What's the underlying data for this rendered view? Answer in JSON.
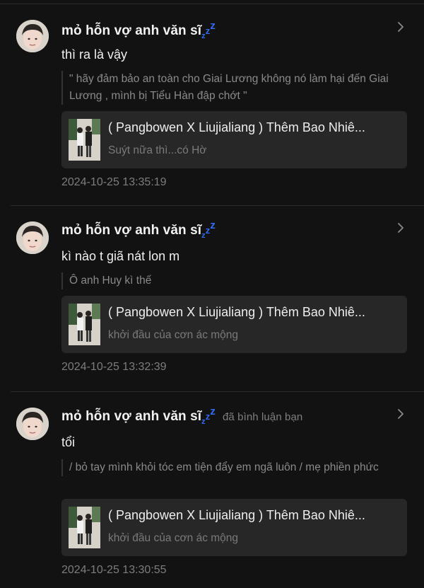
{
  "notifications": [
    {
      "username": "mỏ hỗn vợ anh văn sĩ",
      "zzz": [
        "z",
        "z",
        "z"
      ],
      "action": "",
      "comment": "thì ra là vậy",
      "quote": "\" hãy đảm bảo an toàn cho Giai Lương không nó làm hại đến Giai Lương , mình bị Tiểu Hàn đập chớt \"",
      "card_title": "( Pangbowen X Liujialiang ) Thêm Bao Nhiê...",
      "card_subtitle": "Suýt nữa thì...có Hờ",
      "timestamp": "2024-10-25 13:35:19"
    },
    {
      "username": "mỏ hỗn vợ anh văn sĩ",
      "zzz": [
        "z",
        "z",
        "z"
      ],
      "action": "",
      "comment": "kì nào t giã nát lon m",
      "quote": "Ô anh Huy kì thế",
      "card_title": "( Pangbowen X Liujialiang ) Thêm Bao Nhiê...",
      "card_subtitle": "khởi đầu của cơn ác mộng",
      "timestamp": "2024-10-25 13:32:39"
    },
    {
      "username": "mỏ hỗn vợ anh văn sĩ",
      "zzz": [
        "z",
        "z",
        "z"
      ],
      "action": "đã bình luận bạn",
      "comment": "tổi",
      "quote": "/ bỏ tay mình khỏi tóc em tiện đẩy em ngã luôn / mẹ phiền phức",
      "card_title": "( Pangbowen X Liujialiang ) Thêm Bao Nhiê...",
      "card_subtitle": "khởi đầu của cơn ác mộng",
      "timestamp": "2024-10-25 13:30:55"
    }
  ],
  "icons": {
    "chevron": "chevron-right-icon",
    "avatar": "user-avatar",
    "thumbnail": "story-cover-image"
  },
  "colors": {
    "background": "#121212",
    "card": "#272727",
    "zzz_accent": "#2f6cf2",
    "muted_text": "#7d7d7d"
  }
}
